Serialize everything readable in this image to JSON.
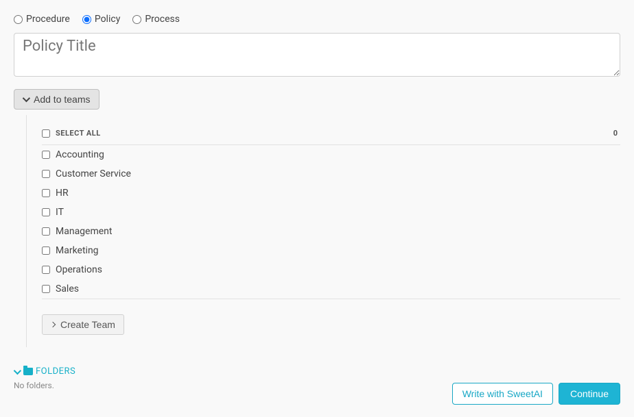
{
  "doc_type": {
    "options": [
      {
        "value": "procedure",
        "label": "Procedure",
        "checked": false
      },
      {
        "value": "policy",
        "label": "Policy",
        "checked": true
      },
      {
        "value": "process",
        "label": "Process",
        "checked": false
      }
    ]
  },
  "title_input": {
    "placeholder": "Policy Title",
    "value": ""
  },
  "teams_toggle": {
    "label": "Add to teams"
  },
  "teams": {
    "select_all_label": "SELECT ALL",
    "selected_count": "0",
    "items": [
      {
        "label": "Accounting",
        "checked": false
      },
      {
        "label": "Customer Service",
        "checked": false
      },
      {
        "label": "HR",
        "checked": false
      },
      {
        "label": "IT",
        "checked": false
      },
      {
        "label": "Management",
        "checked": false
      },
      {
        "label": "Marketing",
        "checked": false
      },
      {
        "label": "Operations",
        "checked": false
      },
      {
        "label": "Sales",
        "checked": false
      }
    ],
    "create_team_label": "Create Team"
  },
  "folders": {
    "header_label": "FOLDERS",
    "empty_text": "No folders."
  },
  "footer": {
    "ai_button": "Write with SweetAI",
    "continue_button": "Continue"
  }
}
